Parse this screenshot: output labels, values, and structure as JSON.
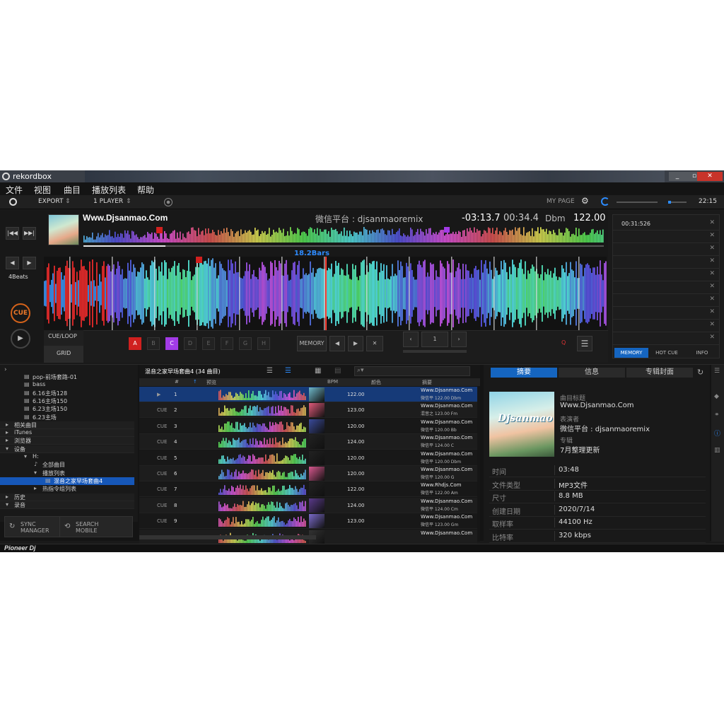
{
  "window": {
    "title": "rekordbox",
    "minimize": "_",
    "maximize": "▫",
    "close": "✕"
  },
  "menu": [
    "文件",
    "视图",
    "曲目",
    "播放列表",
    "帮助"
  ],
  "toolbar": {
    "mode": "EXPORT",
    "players": "1 PLAYER",
    "mypage": "MY PAGE",
    "clock": "22:15"
  },
  "deck": {
    "title": "Www.Djsanmao.Com",
    "artist": "微信平台 : djsanmaoremix",
    "remaining": "-03:13.7",
    "elapsed": "00:34.4",
    "key": "Dbm",
    "bpm": "122.00",
    "bars_label": "18.2Bars",
    "beats": "4Beats",
    "cue": "CUE",
    "play": "▶",
    "nav_prev": "|◀◀",
    "nav_next": "▶▶|",
    "beat_prev": "◀",
    "beat_next": "▶",
    "cue_loop": "CUE/LOOP",
    "grid": "GRID",
    "hotcues": [
      "A",
      "B",
      "C",
      "D",
      "E",
      "F",
      "G",
      "H"
    ],
    "memory": "MEMORY",
    "loop_value": "1",
    "quantize": "Q"
  },
  "memory_panel": {
    "entries": [
      "00:31:526",
      "",
      "",
      "",
      "",
      "",
      "",
      "",
      "",
      ""
    ],
    "tabs": [
      "MEMORY",
      "HOT CUE",
      "INFO"
    ]
  },
  "tree": {
    "items": [
      {
        "label": "pop-前场套路-01"
      },
      {
        "label": "bass"
      },
      {
        "label": "6.16主场128"
      },
      {
        "label": "6.16主场150"
      },
      {
        "label": "6.23主场150"
      },
      {
        "label": "6.23主场"
      },
      {
        "label": "相关曲目"
      },
      {
        "label": "iTunes"
      },
      {
        "label": "浏览器"
      },
      {
        "label": "设备"
      },
      {
        "label": "H:"
      },
      {
        "label": "全部曲目"
      },
      {
        "label": "播放列表"
      },
      {
        "label": "混音之家早场套曲4"
      },
      {
        "label": "热指令组列表"
      },
      {
        "label": "历史"
      },
      {
        "label": "录音"
      }
    ],
    "sync": [
      "SYNC",
      "MANAGER"
    ],
    "search": [
      "SEARCH",
      "MOBILE"
    ]
  },
  "tracks": {
    "title": "混音之家早场套曲4 (34 曲目)",
    "headers": {
      "num": "#",
      "preview": "预览",
      "bpm": "BPM",
      "color": "颜色",
      "summary": "摘要"
    },
    "rows": [
      {
        "cue": "▶",
        "num": "1",
        "bpm": "122.00",
        "l1": "Www.Djsanmao.Com",
        "l2": "微信平   122.00   Dbm"
      },
      {
        "cue": "CUE",
        "num": "2",
        "bpm": "123.00",
        "l1": "Www.Djsanmao.Com",
        "l2": "混音之   123.00   Fm"
      },
      {
        "cue": "CUE",
        "num": "3",
        "bpm": "120.00",
        "l1": "Www.Djsanmao.Com",
        "l2": "微信平   120.00   Bb"
      },
      {
        "cue": "CUE",
        "num": "4",
        "bpm": "124.00",
        "l1": "Www.Djsanmao.Com",
        "l2": "微信平   124.00   C"
      },
      {
        "cue": "CUE",
        "num": "5",
        "bpm": "120.00",
        "l1": "Www.Djsanmao.Com",
        "l2": "微信平   120.00   Dbm"
      },
      {
        "cue": "CUE",
        "num": "6",
        "bpm": "120.00",
        "l1": "Www.Djsanmao.Com",
        "l2": "微信平   120.00   G"
      },
      {
        "cue": "CUE",
        "num": "7",
        "bpm": "122.00",
        "l1": "Www.Rhdjs.Com",
        "l2": "微信平   122.00   Am"
      },
      {
        "cue": "CUE",
        "num": "8",
        "bpm": "124.00",
        "l1": "Www.Djsanmao.Com",
        "l2": "微信平   124.00   Cm"
      },
      {
        "cue": "CUE",
        "num": "9",
        "bpm": "123.00",
        "l1": "Www.Djsanmao.Com",
        "l2": "微信平   123.00   Gm"
      },
      {
        "cue": "CUE",
        "num": "10",
        "bpm": "",
        "l1": "Www.Djsanmao.Com",
        "l2": ""
      }
    ]
  },
  "info": {
    "tabs": [
      "摘要",
      "信息",
      "专辑封面"
    ],
    "cover_text": "Djsanmao",
    "title_label": "曲目标题",
    "title_value": "Www.Djsanmao.Com",
    "artist_label": "表演者",
    "artist_value": "微信平台 : djsanmaoremix",
    "album_label": "专辑",
    "album_value": "7月整理更新",
    "rows": [
      {
        "k": "时间",
        "v": "03:48"
      },
      {
        "k": "文件类型",
        "v": "MP3文件"
      },
      {
        "k": "尺寸",
        "v": "8.8 MB"
      },
      {
        "k": "创建日期",
        "v": "2020/7/14"
      },
      {
        "k": "取样率",
        "v": "44100 Hz"
      },
      {
        "k": "比特率",
        "v": "320 kbps"
      }
    ]
  },
  "status": {
    "brand": "Pioneer Dj"
  }
}
